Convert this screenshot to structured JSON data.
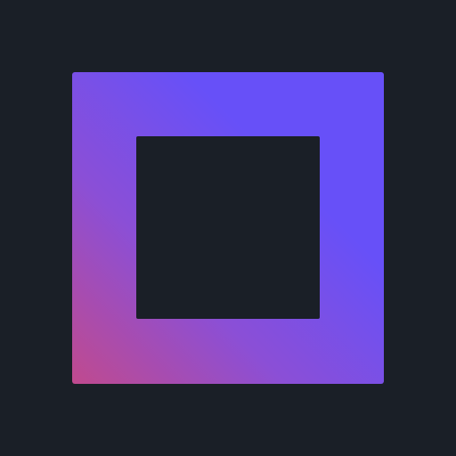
{
  "icon": {
    "name": "square-frame-logo",
    "colors": {
      "background": "#1a1f27",
      "gradient_start": "#c04a8e",
      "gradient_mid": "#8b4fd6",
      "gradient_end": "#6750f8",
      "inner_cutout": "#1a1f27"
    }
  }
}
